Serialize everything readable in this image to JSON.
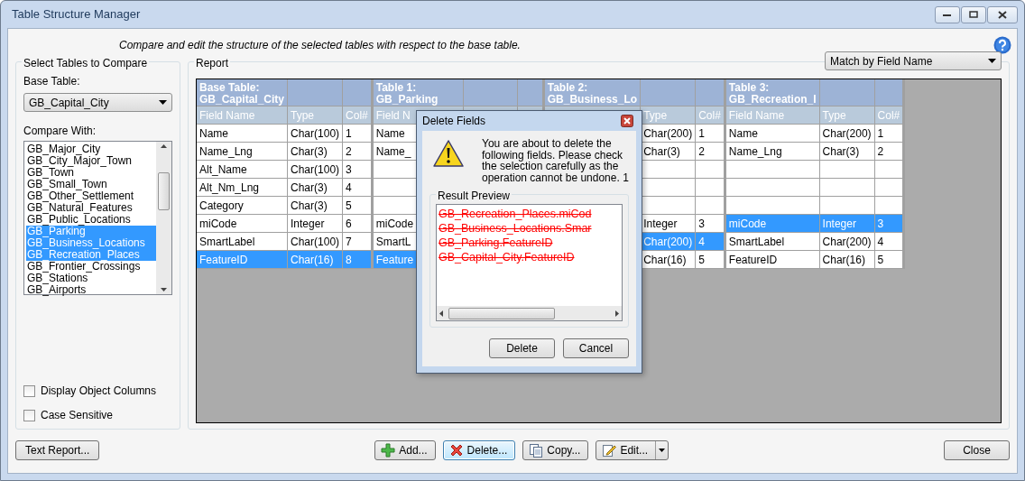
{
  "window": {
    "title": "Table Structure Manager"
  },
  "subtitle": "Compare and edit the structure of the selected tables with respect to the base table.",
  "select_tables": {
    "label": "Select Tables to Compare",
    "base_table_label": "Base Table:",
    "base_table": {
      "value": "GB_Capital_City"
    },
    "compare_with_label": "Compare With:",
    "compare_with": [
      {
        "label": "GB_Major_City",
        "selected": false
      },
      {
        "label": "GB_City_Major_Town",
        "selected": false
      },
      {
        "label": "GB_Town",
        "selected": false
      },
      {
        "label": "GB_Small_Town",
        "selected": false
      },
      {
        "label": "GB_Other_Settlement",
        "selected": false
      },
      {
        "label": "GB_Natural_Features",
        "selected": false
      },
      {
        "label": "GB_Public_Locations",
        "selected": false
      },
      {
        "label": "GB_Parking",
        "selected": true
      },
      {
        "label": "GB_Business_Locations",
        "selected": true
      },
      {
        "label": "GB_Recreation_Places",
        "selected": true
      },
      {
        "label": "GB_Frontier_Crossings",
        "selected": false
      },
      {
        "label": "GB_Stations",
        "selected": false
      },
      {
        "label": "GB_Airports",
        "selected": false
      }
    ],
    "options": [
      {
        "label": "Display Object Columns",
        "checked": false
      },
      {
        "label": "Case Sensitive",
        "checked": false
      }
    ]
  },
  "report": {
    "label": "Report",
    "match_by": {
      "value": "Match by Field Name"
    },
    "tables": [
      {
        "title": "Base Table:",
        "name": "GB_Capital_City",
        "headers": {
          "field": "Field Name",
          "type": "Type",
          "col": "Col#"
        },
        "rows": [
          {
            "field": "Name",
            "type": "Char(100)",
            "col": "1",
            "selected": false
          },
          {
            "field": "Name_Lng",
            "type": "Char(3)",
            "col": "2",
            "selected": false
          },
          {
            "field": "Alt_Name",
            "type": "Char(100)",
            "col": "3",
            "selected": false
          },
          {
            "field": "Alt_Nm_Lng",
            "type": "Char(3)",
            "col": "4",
            "selected": false
          },
          {
            "field": "Category",
            "type": "Char(3)",
            "col": "5",
            "selected": false
          },
          {
            "field": "miCode",
            "type": "Integer",
            "col": "6",
            "selected": false
          },
          {
            "field": "SmartLabel",
            "type": "Char(100)",
            "col": "7",
            "selected": false
          },
          {
            "field": "FeatureID",
            "type": "Char(16)",
            "col": "8",
            "selected": true
          }
        ]
      },
      {
        "title": "Table 1:",
        "name": "GB_Parking",
        "headers": {
          "field": "Field N"
        },
        "rows": [
          {
            "field": "Name",
            "selected": false
          },
          {
            "field": "Name_",
            "selected": false
          },
          {
            "selected": false
          },
          {
            "selected": false
          },
          {
            "selected": false
          },
          {
            "field": "miCode",
            "selected": false
          },
          {
            "field": "SmartL",
            "selected": false
          },
          {
            "field": "Feature",
            "selected": true
          }
        ]
      },
      {
        "title": "Table 2:",
        "name": "GB_Business_Lo",
        "headers": {
          "type": "Type",
          "col": "Col#"
        },
        "rows": [
          {
            "type": "Char(200)",
            "col": "1",
            "selected": false
          },
          {
            "type": "Char(3)",
            "col": "2",
            "selected": false
          },
          {
            "selected": false
          },
          {
            "selected": false
          },
          {
            "selected": false
          },
          {
            "type": "Integer",
            "col": "3",
            "selected": false
          },
          {
            "type": "Char(200)",
            "col": "4",
            "selected": true
          },
          {
            "type": "Char(16)",
            "col": "5",
            "selected": false
          }
        ]
      },
      {
        "title": "Table 3:",
        "name": "GB_Recreation_I",
        "headers": {
          "field": "Field Name",
          "type": "Type",
          "col": "Col#"
        },
        "rows": [
          {
            "field": "Name",
            "type": "Char(200)",
            "col": "1",
            "selected": false
          },
          {
            "field": "Name_Lng",
            "type": "Char(3)",
            "col": "2",
            "selected": false
          },
          {
            "selected": false
          },
          {
            "selected": false
          },
          {
            "selected": false
          },
          {
            "field": "miCode",
            "type": "Integer",
            "col": "3",
            "selected": true
          },
          {
            "field": "SmartLabel",
            "type": "Char(200)",
            "col": "4",
            "selected": false
          },
          {
            "field": "FeatureID",
            "type": "Char(16)",
            "col": "5",
            "selected": false
          }
        ]
      }
    ]
  },
  "bottom_left": {
    "label": "Text Report..."
  },
  "actions": [
    {
      "kind": "add",
      "label": "Add...",
      "focused": false
    },
    {
      "kind": "delete",
      "label": "Delete...",
      "focused": true
    },
    {
      "kind": "copy",
      "label": "Copy...",
      "focused": false
    },
    {
      "kind": "edit",
      "label": "Edit...",
      "focused": false
    }
  ],
  "close": {
    "label": "Close"
  },
  "dialog": {
    "title": "Delete Fields",
    "message": "You are about to delete the following fields. Please check the selection carefully as the operation cannot be undone. 1",
    "preview_label": "Result Preview",
    "preview_items": [
      "GB_Recreation_Places.miCod",
      "GB_Business_Locations.Smar",
      "GB_Parking.FeatureID",
      "GB_Capital_City.FeatureID"
    ],
    "buttons": [
      {
        "label": "Delete"
      },
      {
        "label": "Cancel"
      }
    ]
  }
}
